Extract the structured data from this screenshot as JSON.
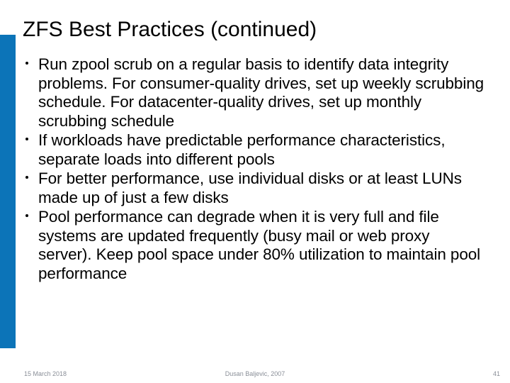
{
  "title": "ZFS Best Practices (continued)",
  "bullets": [
    "Run zpool scrub on a regular basis to identify data integrity problems. For consumer-quality drives, set up weekly scrubbing schedule. For datacenter-quality drives, set up monthly scrubbing schedule",
    "If workloads have predictable performance characteristics, separate loads into different pools",
    "For better performance, use individual disks or at least LUNs made up of just a few disks",
    "Pool performance can degrade when it is very full and file systems are updated frequently (busy mail or web proxy server). Keep pool space under 80% utilization to maintain pool performance"
  ],
  "footer": {
    "date": "15 March 2018",
    "center": "Dusan Baljevic, 2007",
    "page": "41"
  }
}
